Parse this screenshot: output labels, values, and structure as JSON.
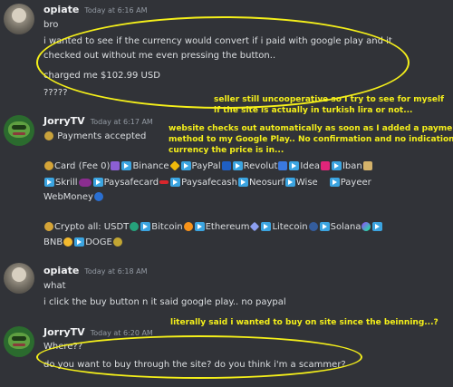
{
  "messages": [
    {
      "author": "opiate",
      "timestamp": "Today at 6:16 AM",
      "lines": [
        "bro",
        "i wanted to see if the currency would convert if i paid with google play and it",
        "checked out without me even pressing the button..",
        "charged me $102.99 USD",
        "?????"
      ]
    },
    {
      "author": "JorryTV",
      "timestamp": "Today at 6:17 AM",
      "payments_header": "Payments accepted",
      "card_label": "Card (Fee 0)",
      "card_methods": [
        "Binance",
        "PayPal",
        "Revolut",
        "Idea",
        "Iban",
        "Skrill",
        "Paysafecard",
        "Paysafecash",
        "Neosurf",
        "Wise",
        "Payeer",
        "WebMoney"
      ],
      "crypto_label": "Crypto all: USDT",
      "crypto_methods": [
        "Bitcoin",
        "Ethereum",
        "Litecoin",
        "Solana",
        "BNB",
        "DOGE"
      ]
    },
    {
      "author": "opiate",
      "timestamp": "Today at 6:18 AM",
      "lines": [
        "what",
        "i click the buy button n it said google play.. no paypal"
      ]
    },
    {
      "author": "JorryTV",
      "timestamp": "Today at 6:20 AM",
      "lines": [
        "Where??",
        "do you want to buy through the site? do you think i'm a scammer?"
      ]
    }
  ],
  "annotations": {
    "note1": [
      "seller still uncooperative so I try to see for myself",
      "if the site is actually in turkish lira or not..."
    ],
    "note2": [
      "website checks out automatically as soon as I added a payment",
      "method to my Google Play.. No confirmation and no indication of",
      "currency the price is in..."
    ],
    "note3": "literally said i wanted to buy on site since the beinning...?"
  },
  "colors": {
    "background": "#313338",
    "annotation": "#f5f01a",
    "username": "#f2f3f5",
    "timestamp": "#949ba4"
  }
}
